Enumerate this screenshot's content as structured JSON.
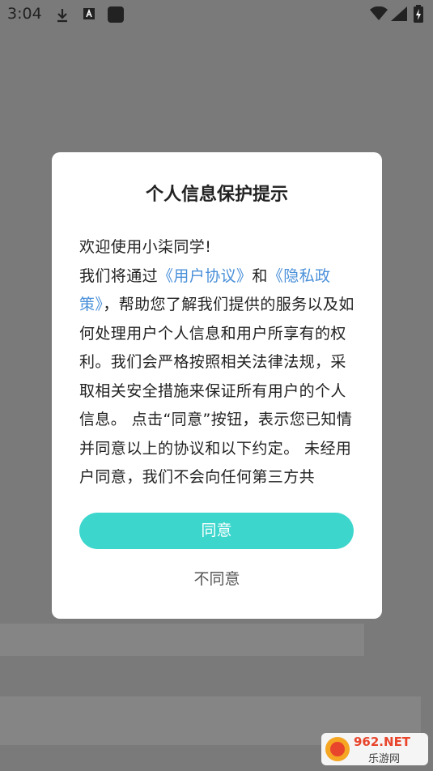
{
  "status_bar": {
    "time": "3:04",
    "icons": [
      "download-icon",
      "accessibility-icon",
      "app-square-icon",
      "wifi-icon",
      "signal-icon",
      "battery-charging-icon"
    ]
  },
  "dialog": {
    "title": "个人信息保护提示",
    "lines": [
      "欢迎使用小柒同学!",
      "我们将通过",
      "《用户协议》",
      "和",
      "《隐私政策》",
      "，帮助您了解我们提供的服务以及如何处理用户个人信息和用户所享有的权利。我们会严格按照相关法律法规，采取相关安全措施来保证所有用户的个人信息。 点击“同意”按钮，表示您已知情并同意以上的协议和以下约定。 未经用户同意，我们不会向任何第三方共"
    ],
    "agree_label": "同意",
    "disagree_label": "不同意"
  },
  "watermark": {
    "brand": "962.NET",
    "sub": "乐游网"
  }
}
